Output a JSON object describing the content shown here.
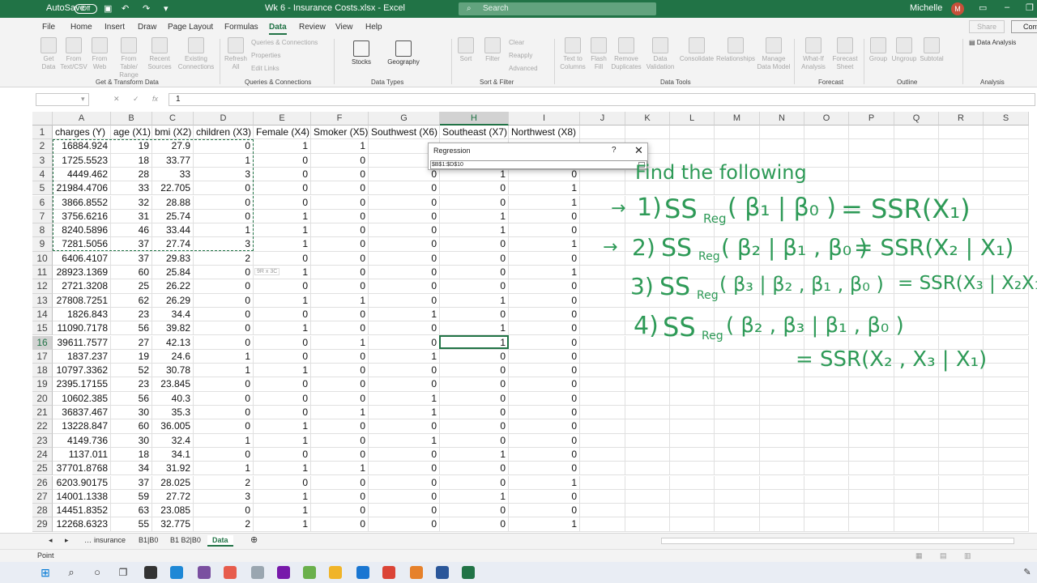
{
  "titlebar": {
    "autosave_label": "AutoSave",
    "autosave_state": "Off",
    "doc_title": "Wk 6 - Insurance Costs.xlsx - Excel",
    "search_placeholder": "Search",
    "user_name": "Michelle",
    "user_initial": "M"
  },
  "menu": {
    "tabs": [
      "File",
      "Home",
      "Insert",
      "Draw",
      "Page Layout",
      "Formulas",
      "Data",
      "Review",
      "View",
      "Help"
    ],
    "active": "Data",
    "share_label": "Share",
    "comments_label": "Com"
  },
  "ribbon": {
    "groups": [
      {
        "caption": "Get & Transform Data",
        "buttons": [
          "Get Data",
          "From Text/CSV",
          "From Web",
          "From Table/ Range",
          "Recent Sources",
          "Existing Connections"
        ]
      },
      {
        "caption": "Queries & Connections",
        "buttons": [
          "Refresh All"
        ],
        "small": [
          "Queries & Connections",
          "Properties",
          "Edit Links"
        ]
      },
      {
        "caption": "Data Types",
        "buttons": [
          "Stocks",
          "Geography"
        ]
      },
      {
        "caption": "Sort & Filter",
        "buttons": [
          "Sort",
          "Filter"
        ],
        "small": [
          "Clear",
          "Reapply",
          "Advanced"
        ]
      },
      {
        "caption": "Data Tools",
        "buttons": [
          "Text to Columns",
          "Flash Fill",
          "Remove Duplicates",
          "Data Validation",
          "Consolidate",
          "Relationships",
          "Manage Data Model"
        ]
      },
      {
        "caption": "Forecast",
        "buttons": [
          "What-If Analysis",
          "Forecast Sheet"
        ]
      },
      {
        "caption": "Outline",
        "buttons": [
          "Group",
          "Ungroup",
          "Subtotal"
        ]
      },
      {
        "caption": "Analysis",
        "buttons": [
          "Data Analysis"
        ]
      }
    ]
  },
  "formula_bar": {
    "name_box": "",
    "cancel_icon": "✕",
    "enter_icon": "✓",
    "fx_label": "fx",
    "formula": "1"
  },
  "sheet": {
    "columns": [
      "A",
      "B",
      "C",
      "D",
      "E",
      "F",
      "G",
      "H",
      "I",
      "J",
      "K",
      "L",
      "M",
      "N",
      "O",
      "P",
      "Q",
      "R",
      "S"
    ],
    "selected_column": "H",
    "selected_row": 16,
    "header_row": [
      "charges (Y)",
      "age (X1)",
      "bmi (X2)",
      "children (X3)",
      "Female (X4)",
      "Smoker (X5)",
      "Southwest (X6)",
      "Southeast (X7)",
      "Northwest (X8)"
    ],
    "rows": [
      [
        "16884.924",
        "19",
        "27.9",
        "0",
        "1",
        "1",
        "",
        "",
        ""
      ],
      [
        "1725.5523",
        "18",
        "33.77",
        "1",
        "0",
        "0",
        "",
        "",
        ""
      ],
      [
        "4449.462",
        "28",
        "33",
        "3",
        "0",
        "0",
        "0",
        "1",
        "0"
      ],
      [
        "21984.4706",
        "33",
        "22.705",
        "0",
        "0",
        "0",
        "0",
        "0",
        "1"
      ],
      [
        "3866.8552",
        "32",
        "28.88",
        "0",
        "0",
        "0",
        "0",
        "0",
        "1"
      ],
      [
        "3756.6216",
        "31",
        "25.74",
        "0",
        "1",
        "0",
        "0",
        "1",
        "0"
      ],
      [
        "8240.5896",
        "46",
        "33.44",
        "1",
        "1",
        "0",
        "0",
        "1",
        "0"
      ],
      [
        "7281.5056",
        "37",
        "27.74",
        "3",
        "1",
        "0",
        "0",
        "0",
        "1"
      ],
      [
        "6406.4107",
        "37",
        "29.83",
        "2",
        "0",
        "0",
        "0",
        "0",
        "0"
      ],
      [
        "28923.1369",
        "60",
        "25.84",
        "0",
        "1",
        "0",
        "0",
        "0",
        "1"
      ],
      [
        "2721.3208",
        "25",
        "26.22",
        "0",
        "0",
        "0",
        "0",
        "0",
        "0"
      ],
      [
        "27808.7251",
        "62",
        "26.29",
        "0",
        "1",
        "1",
        "0",
        "1",
        "0"
      ],
      [
        "1826.843",
        "23",
        "34.4",
        "0",
        "0",
        "0",
        "1",
        "0",
        "0"
      ],
      [
        "11090.7178",
        "56",
        "39.82",
        "0",
        "1",
        "0",
        "0",
        "1",
        "0"
      ],
      [
        "39611.7577",
        "27",
        "42.13",
        "0",
        "0",
        "1",
        "0",
        "1",
        "0"
      ],
      [
        "1837.237",
        "19",
        "24.6",
        "1",
        "0",
        "0",
        "1",
        "0",
        "0"
      ],
      [
        "10797.3362",
        "52",
        "30.78",
        "1",
        "1",
        "0",
        "0",
        "0",
        "0"
      ],
      [
        "2395.17155",
        "23",
        "23.845",
        "0",
        "0",
        "0",
        "0",
        "0",
        "0"
      ],
      [
        "10602.385",
        "56",
        "40.3",
        "0",
        "0",
        "0",
        "1",
        "0",
        "0"
      ],
      [
        "36837.467",
        "30",
        "35.3",
        "0",
        "0",
        "1",
        "1",
        "0",
        "0"
      ],
      [
        "13228.847",
        "60",
        "36.005",
        "0",
        "1",
        "0",
        "0",
        "0",
        "0"
      ],
      [
        "4149.736",
        "30",
        "32.4",
        "1",
        "1",
        "0",
        "1",
        "0",
        "0"
      ],
      [
        "1137.011",
        "18",
        "34.1",
        "0",
        "0",
        "0",
        "0",
        "1",
        "0"
      ],
      [
        "37701.8768",
        "34",
        "31.92",
        "1",
        "1",
        "1",
        "0",
        "0",
        "0"
      ],
      [
        "6203.90175",
        "37",
        "28.025",
        "2",
        "0",
        "0",
        "0",
        "0",
        "1"
      ],
      [
        "14001.1338",
        "59",
        "27.72",
        "3",
        "1",
        "0",
        "0",
        "1",
        "0"
      ],
      [
        "14451.8352",
        "63",
        "23.085",
        "0",
        "1",
        "0",
        "0",
        "0",
        "0"
      ],
      [
        "12268.6323",
        "55",
        "32.775",
        "2",
        "1",
        "0",
        "0",
        "0",
        "1"
      ]
    ],
    "range_tooltip": "9R x 3C"
  },
  "regression_dialog": {
    "title": "Regression",
    "help": "?",
    "close": "✕",
    "ref_value": "$B$1:$D$10"
  },
  "handwriting": {
    "heading": "Find the following",
    "items": [
      {
        "arrow": "→",
        "num": "1)",
        "lhs": "SS",
        "sub": "Reg",
        "args": "( β₁ | β₀ )",
        "rhs": "= SSR(X₁)"
      },
      {
        "arrow": "→",
        "num": "2)",
        "lhs": "SS",
        "sub": "Reg",
        "args": "( β₂ | β₁ , β₀ )",
        "rhs": "= SSR(X₂ | X₁)"
      },
      {
        "arrow": "",
        "num": "3)",
        "lhs": "SS",
        "sub": "Reg",
        "args": "( β₃ | β₂ , β₁ , β₀ )",
        "rhs": "= SSR(X₃ | X₂X₁)"
      },
      {
        "arrow": "",
        "num": "4)",
        "lhs": "SS",
        "sub": "Reg",
        "args": "( β₂ , β₃ | β₁ , β₀ )",
        "rhs": ""
      }
    ],
    "continuation": "= SSR(X₂ , X₃ | X₁)",
    "color": "#2e9a57"
  },
  "sheet_tabs": {
    "tabs": [
      "insurance",
      "B1|B0",
      "B1 B2|B0",
      "Data"
    ],
    "active": "Data",
    "add": "⊕"
  },
  "status": {
    "mode": "Point"
  },
  "colors": {
    "brand": "#217346"
  }
}
